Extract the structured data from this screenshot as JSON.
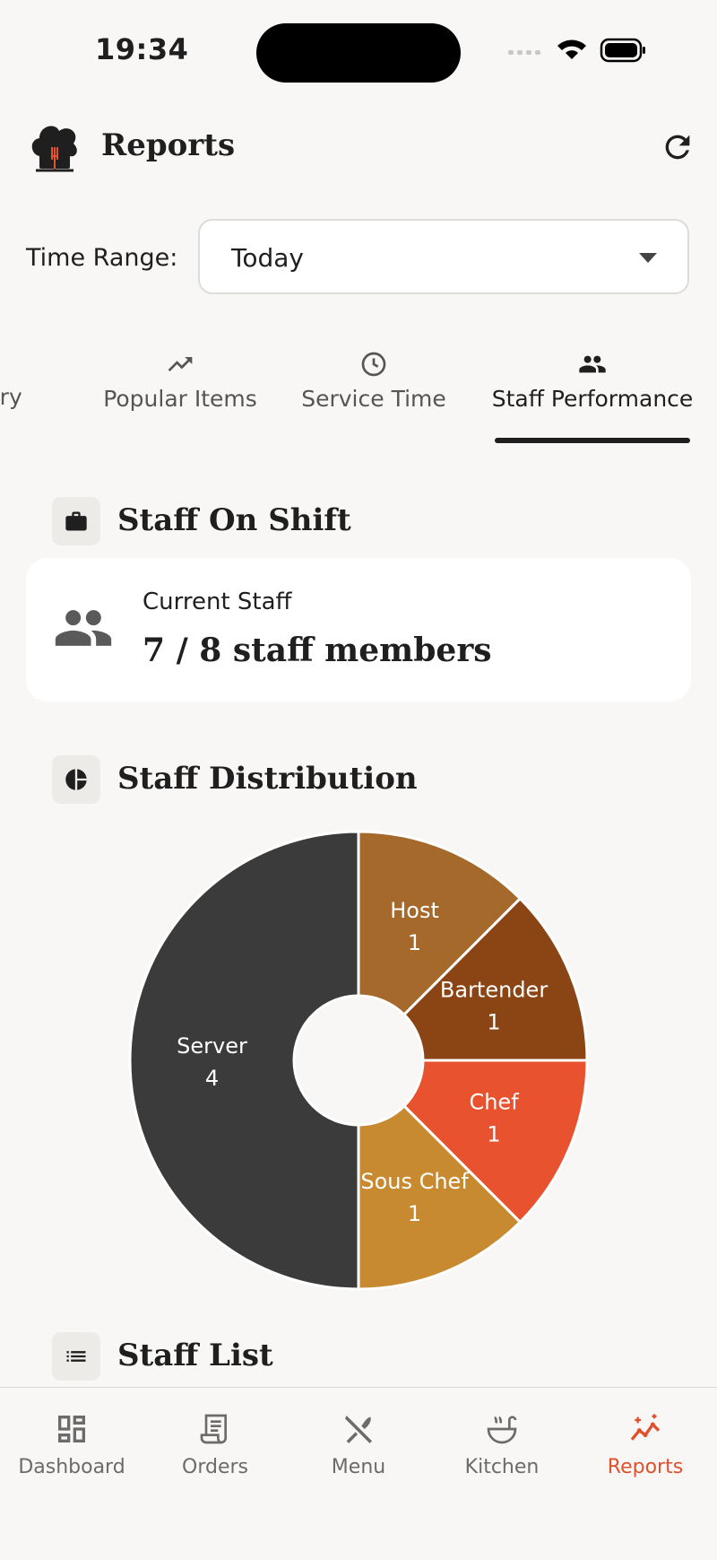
{
  "status_bar": {
    "time": "19:34"
  },
  "header": {
    "title": "Reports"
  },
  "time_range": {
    "label": "Time Range:",
    "selected": "Today"
  },
  "tabs": [
    {
      "label": "mary",
      "icon": "summary-icon"
    },
    {
      "label": "Popular Items",
      "icon": "trending-up-icon"
    },
    {
      "label": "Service Time",
      "icon": "clock-icon"
    },
    {
      "label": "Staff Performance",
      "icon": "people-icon",
      "active": true
    }
  ],
  "staff_on_shift": {
    "title": "Staff On Shift",
    "card_label": "Current Staff",
    "card_value": "7 / 8 staff members"
  },
  "staff_distribution": {
    "title": "Staff Distribution"
  },
  "staff_list": {
    "title": "Staff List"
  },
  "chart_data": {
    "type": "pie",
    "donut": true,
    "categories": [
      "Host",
      "Bartender",
      "Chef",
      "Sous Chef",
      "Server"
    ],
    "values": [
      1,
      1,
      1,
      1,
      4
    ],
    "colors": [
      "#a5692c",
      "#8b4414",
      "#e8522e",
      "#c88a30",
      "#3b3b3b"
    ],
    "data_labels": [
      "1",
      "1",
      "1",
      "1",
      "4"
    ]
  },
  "bottom_nav": [
    {
      "label": "Dashboard",
      "icon": "dashboard-icon"
    },
    {
      "label": "Orders",
      "icon": "receipt-icon"
    },
    {
      "label": "Menu",
      "icon": "utensils-icon"
    },
    {
      "label": "Kitchen",
      "icon": "soup-icon"
    },
    {
      "label": "Reports",
      "icon": "chart-sparkle-icon",
      "active": true
    }
  ],
  "colors": {
    "accent": "#e1502c",
    "background": "#f8f7f5",
    "dark": "#1f1f1f"
  }
}
